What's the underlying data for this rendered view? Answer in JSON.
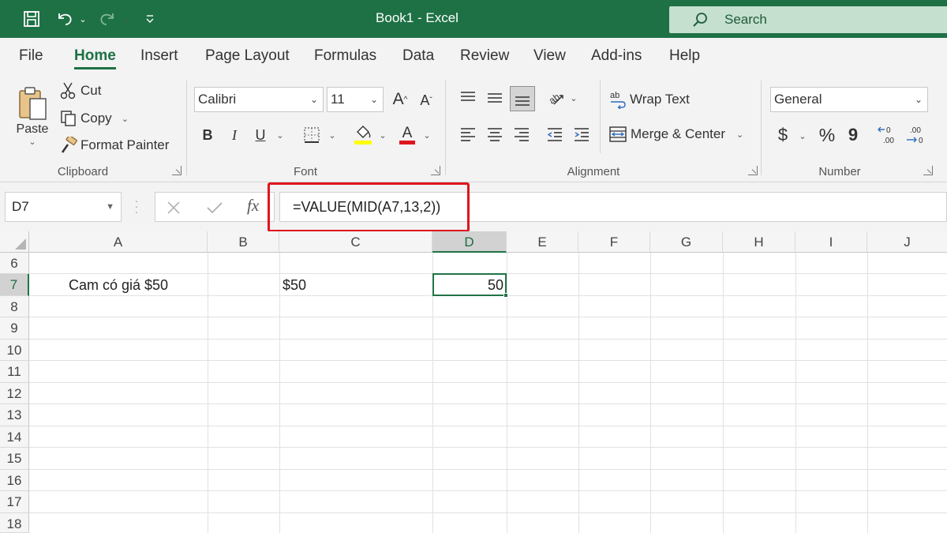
{
  "window": {
    "title": "Book1  -  Excel",
    "search_placeholder": "Search"
  },
  "menu": {
    "tabs": [
      "File",
      "Home",
      "Insert",
      "Page Layout",
      "Formulas",
      "Data",
      "Review",
      "View",
      "Add-ins",
      "Help"
    ],
    "active": "Home"
  },
  "ribbon": {
    "clipboard": {
      "paste": "Paste",
      "cut": "Cut",
      "copy": "Copy",
      "format_painter": "Format Painter",
      "label": "Clipboard"
    },
    "font": {
      "font_name": "Calibri",
      "font_size": "11",
      "bold": "B",
      "italic": "I",
      "underline": "U",
      "label": "Font"
    },
    "alignment": {
      "wrap_text": "Wrap Text",
      "merge_center": "Merge & Center",
      "label": "Alignment"
    },
    "number": {
      "format": "General",
      "currency": "$",
      "percent": "%",
      "comma": "9",
      "label": "Number"
    },
    "colors": {
      "highlight": "#ffff00",
      "font_color": "#e0141e"
    }
  },
  "formula_bar": {
    "name_box": "D7",
    "fx": "fx",
    "formula": "=VALUE(MID(A7,13,2))"
  },
  "grid": {
    "columns": [
      "A",
      "B",
      "C",
      "D",
      "E",
      "F",
      "G",
      "H",
      "I",
      "J"
    ],
    "selected_column": "D",
    "rows": [
      "6",
      "7",
      "8",
      "9",
      "10",
      "11",
      "12",
      "13",
      "14",
      "15",
      "16",
      "17",
      "18"
    ],
    "selected_row": "7",
    "cells": {
      "A7": "Cam có giá $50",
      "C7": "$50",
      "D7": "50"
    }
  },
  "accent_colors": {
    "excel_green": "#1e7145",
    "highlight_box": "#e0141e"
  }
}
